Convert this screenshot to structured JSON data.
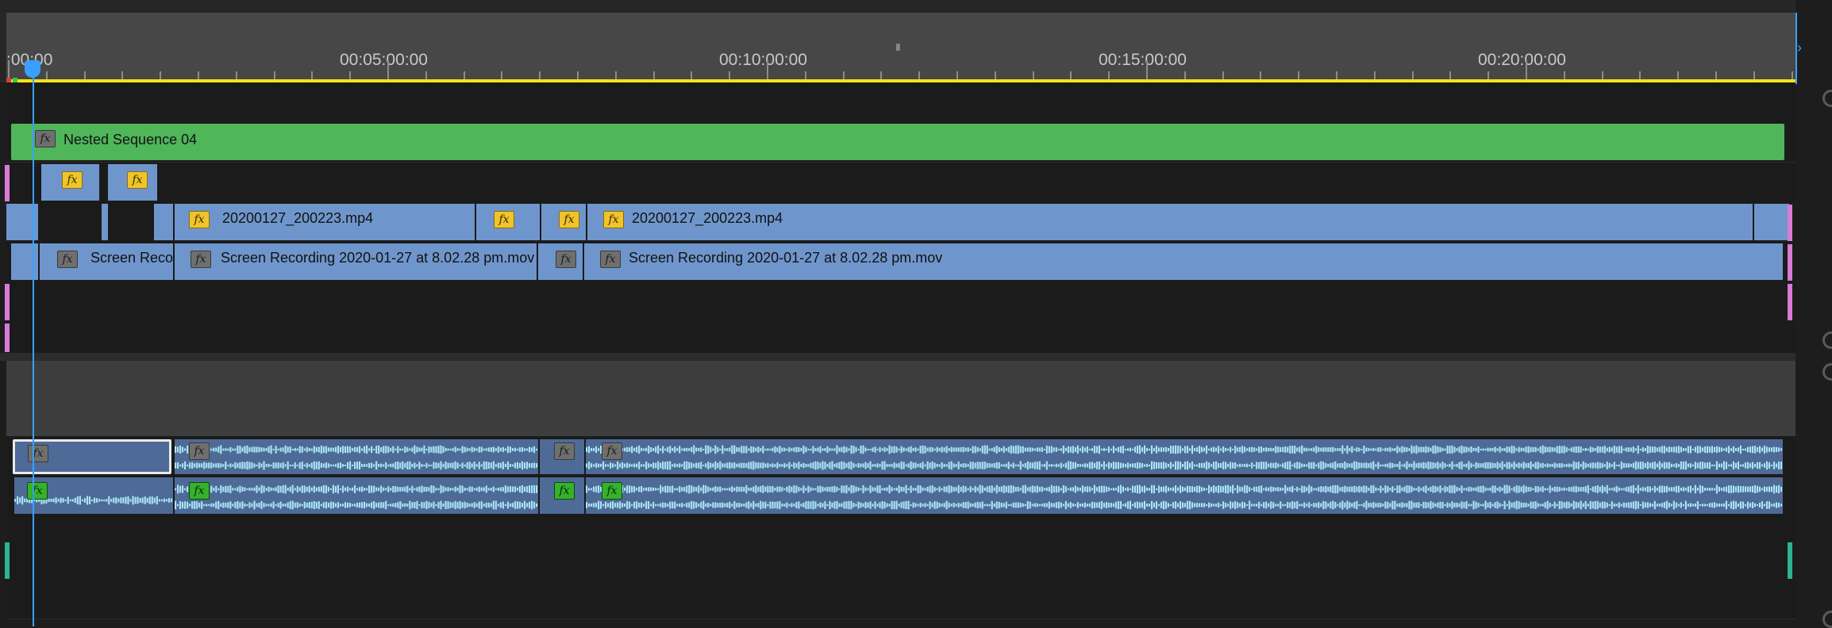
{
  "ruler": {
    "timecodes": [
      ":00:00",
      "00:05:00:00",
      "00:10:00:00",
      "00:15:00:00",
      "00:20:00:00"
    ],
    "grip_glyph": "III"
  },
  "playhead": {
    "timecode": "00:00:00:00"
  },
  "tracks": {
    "v4": {
      "nested_label": "Nested Sequence 04"
    },
    "v2_clip_a": "20200127_200223.mp4",
    "v2_clip_b": "20200127_200223.mp4",
    "v1_clip_a": "Screen Recor",
    "v1_clip_b": "Screen Recording 2020-01-27 at 8.02.28 pm.mov",
    "v1_clip_c": "Screen Recording 2020-01-27 at 8.02.28 pm.mov"
  },
  "fx_label": "fx",
  "colors": {
    "nested_sequence": "#4fb65a",
    "video_clip": "#6f96cc",
    "audio_clip": "#4e6a97",
    "work_area": "#f2e416",
    "playhead": "#3aa0ff",
    "fx_badge_yellow": "#f0c42a",
    "fx_badge_green": "#35b22c",
    "fx_badge_grey": "#6f6f6f"
  }
}
